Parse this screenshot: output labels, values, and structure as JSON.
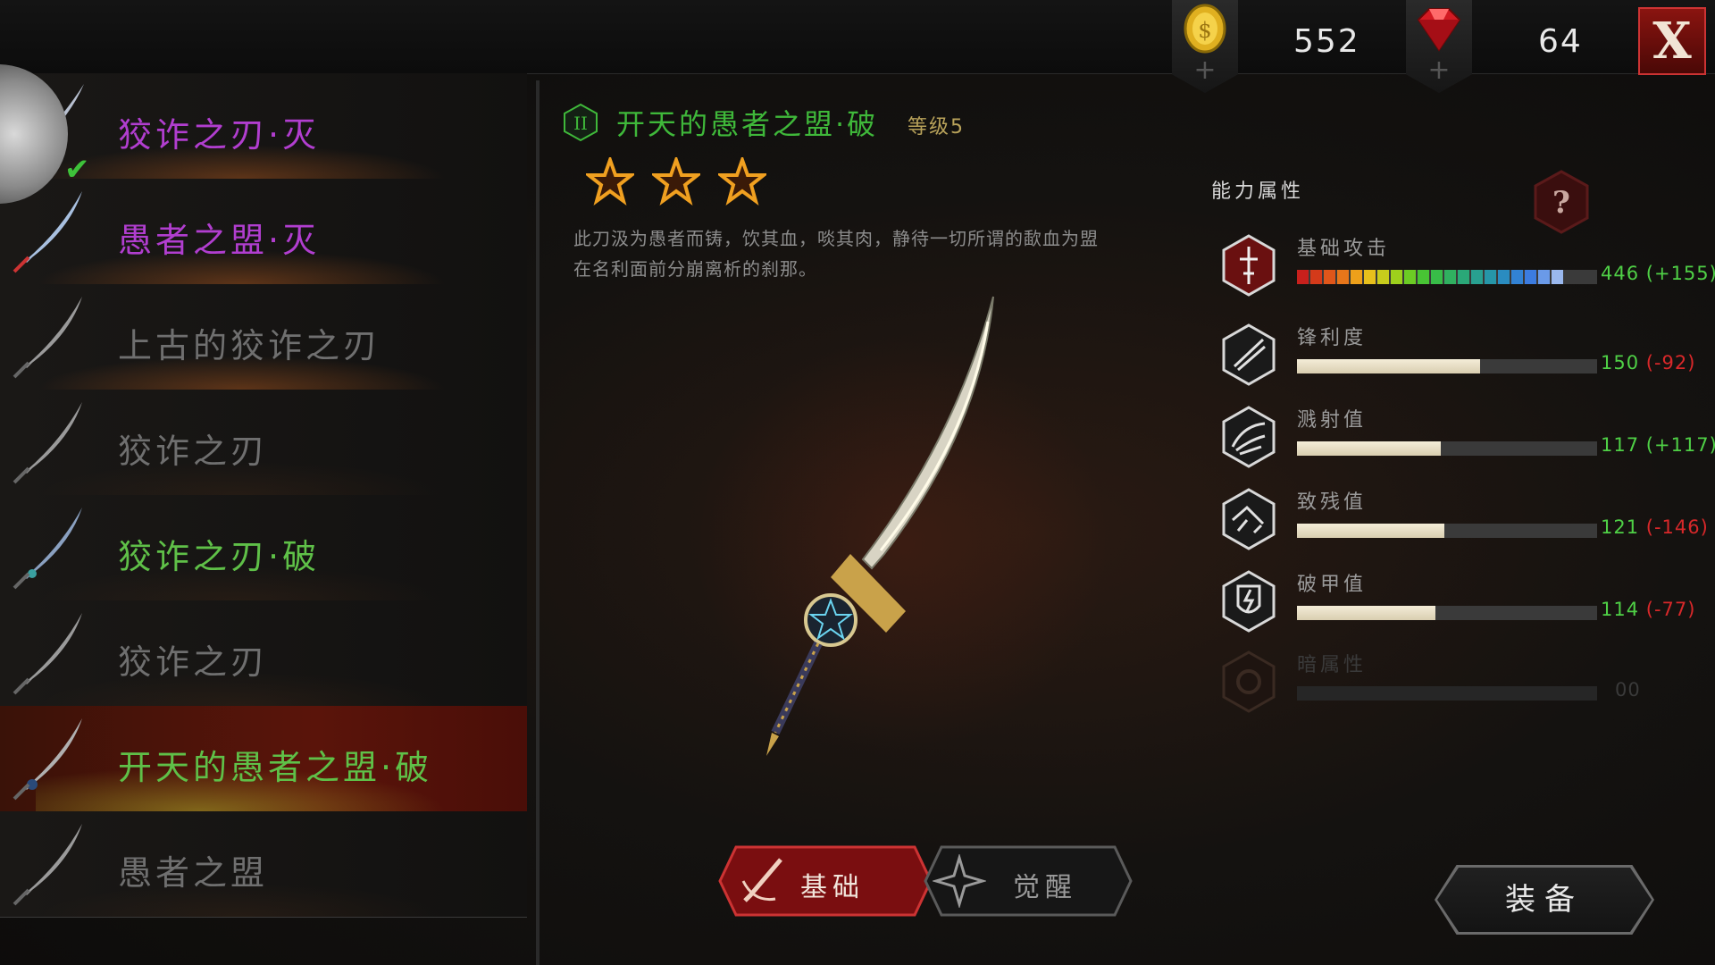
{
  "currency": {
    "gold": "552",
    "gems": "64",
    "add_symbol": "+"
  },
  "close_label": "X",
  "weapon_list": [
    {
      "name": "狡诈之刃·灭",
      "color": "#b13ecf",
      "equipped": true
    },
    {
      "name": "愚者之盟·灭",
      "color": "#b13ecf"
    },
    {
      "name": "上古的狡诈之刃",
      "color": "#6f6f6f"
    },
    {
      "name": "狡诈之刃",
      "color": "#6f6f6f"
    },
    {
      "name": "狡诈之刃·破",
      "color": "#5fc048"
    },
    {
      "name": "狡诈之刃",
      "color": "#6f6f6f"
    },
    {
      "name": "开天的愚者之盟·破",
      "color": "#5fc048",
      "selected": true
    },
    {
      "name": "愚者之盟",
      "color": "#6f6f6f"
    }
  ],
  "detail": {
    "tier": "II",
    "title": "开天的愚者之盟·破",
    "level": "等级5",
    "stars": 3,
    "description": "此刀汲为愚者而铸，饮其血，啖其肉，静待一切所谓的歃血为盟在名利面前分崩离析的刹那。"
  },
  "tabs": {
    "basic": "基础",
    "awaken": "觉醒"
  },
  "equip_label": "装备",
  "stats": {
    "title": "能力属性",
    "help_icon": "question-icon",
    "items": [
      {
        "label": "基础攻击",
        "value": "446",
        "delta": "(+155)",
        "delta_sign": "pos",
        "fill": 0.91,
        "icon": "attack-icon"
      },
      {
        "label": "锋利度",
        "value": "150",
        "delta": "(-92)",
        "delta_sign": "neg",
        "fill": 0.61,
        "icon": "sharpness-icon"
      },
      {
        "label": "溅射值",
        "value": "117",
        "delta": "(+117)",
        "delta_sign": "pos",
        "fill": 0.48,
        "icon": "splash-icon"
      },
      {
        "label": "致残值",
        "value": "121",
        "delta": "(-146)",
        "delta_sign": "neg",
        "fill": 0.49,
        "icon": "cripple-icon"
      },
      {
        "label": "破甲值",
        "value": "114",
        "delta": "(-77)",
        "delta_sign": "neg",
        "fill": 0.46,
        "icon": "armor-break-icon"
      },
      {
        "label": "暗属性",
        "value": "00",
        "delta": "",
        "delta_sign": "",
        "fill": 0,
        "icon": "dark-element-icon",
        "disabled": true
      }
    ]
  },
  "colors": {
    "accent_red": "#c33",
    "positive": "#4fd046",
    "negative": "#d8282a",
    "title_green": "#3fb83a"
  }
}
